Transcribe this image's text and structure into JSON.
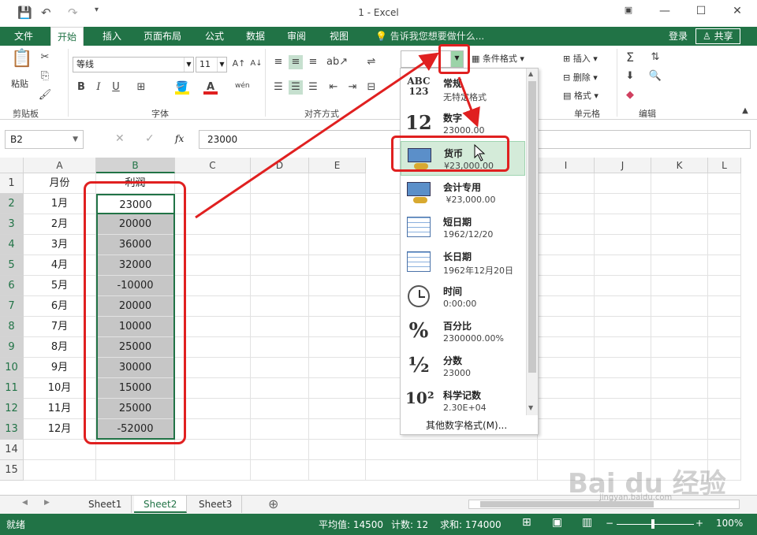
{
  "titlebar": {
    "title": "1 - Excel",
    "save_icon": "save-icon",
    "undo_icon": "undo-icon",
    "redo_icon": "redo-icon"
  },
  "ribbon_tabs": [
    {
      "label": "文件",
      "active": false
    },
    {
      "label": "开始",
      "active": true
    },
    {
      "label": "插入",
      "active": false
    },
    {
      "label": "页面布局",
      "active": false
    },
    {
      "label": "公式",
      "active": false
    },
    {
      "label": "数据",
      "active": false
    },
    {
      "label": "审阅",
      "active": false
    },
    {
      "label": "视图",
      "active": false
    }
  ],
  "tell_me": "告诉我您想要做什么...",
  "login": "登录",
  "share": "共享",
  "ribbon": {
    "paste": "粘贴",
    "clipboard": "剪贴板",
    "font_name": "等线",
    "font_size": "11",
    "font_group": "字体",
    "align_group": "对齐方式",
    "wen": "wén",
    "cond_format": "条件格式",
    "insert": "插入",
    "delete": "删除",
    "format": "格式",
    "cells_group": "单元格",
    "edit_group": "编辑",
    "bold": "B",
    "italic": "I",
    "underline": "U"
  },
  "formula_bar": {
    "name_box": "B2",
    "fx": "fx",
    "value": "23000"
  },
  "columns": [
    "A",
    "B",
    "C",
    "D",
    "E",
    "I",
    "J",
    "K",
    "L"
  ],
  "rows": [
    "1",
    "2",
    "3",
    "4",
    "5",
    "6",
    "7",
    "8",
    "9",
    "10",
    "11",
    "12",
    "13",
    "14",
    "15"
  ],
  "table": {
    "header": [
      "月份",
      "利润"
    ],
    "data": [
      [
        "1月",
        "23000"
      ],
      [
        "2月",
        "20000"
      ],
      [
        "3月",
        "36000"
      ],
      [
        "4月",
        "32000"
      ],
      [
        "5月",
        "-10000"
      ],
      [
        "6月",
        "20000"
      ],
      [
        "7月",
        "10000"
      ],
      [
        "8月",
        "25000"
      ],
      [
        "9月",
        "30000"
      ],
      [
        "10月",
        "15000"
      ],
      [
        "11月",
        "25000"
      ],
      [
        "12月",
        "-52000"
      ]
    ]
  },
  "number_format_dropdown": {
    "items": [
      {
        "icon": "ABC\n123",
        "label": "常规",
        "example": "无特定格式"
      },
      {
        "icon": "12",
        "label": "数字",
        "example": "23000.00"
      },
      {
        "icon": "currency-icon",
        "label": "货币",
        "example": "¥23,000.00"
      },
      {
        "icon": "accounting-icon",
        "label": "会计专用",
        "example": " ¥23,000.00"
      },
      {
        "icon": "calendar-icon",
        "label": "短日期",
        "example": "1962/12/20"
      },
      {
        "icon": "calendar-icon",
        "label": "长日期",
        "example": "1962年12月20日"
      },
      {
        "icon": "clock-icon",
        "label": "时间",
        "example": "0:00:00"
      },
      {
        "icon": "%",
        "label": "百分比",
        "example": "2300000.00%"
      },
      {
        "icon": "½",
        "label": "分数",
        "example": "23000"
      },
      {
        "icon": "10²",
        "label": "科学记数",
        "example": "2.30E+04"
      }
    ],
    "more": "其他数字格式(M)..."
  },
  "sheets": [
    {
      "label": "Sheet1",
      "active": false
    },
    {
      "label": "Sheet2",
      "active": true
    },
    {
      "label": "Sheet3",
      "active": false
    }
  ],
  "status": {
    "ready": "就绪",
    "average": "平均值: 14500",
    "count": "计数: 12",
    "sum": "求和: 174000",
    "zoom": "100%"
  },
  "watermark": "Bai du 经验",
  "watermark_url": "jingyan.baidu.com",
  "colors": {
    "excel_green": "#217346",
    "annotation_red": "#e02020",
    "highlight": "#d4ebd9"
  }
}
